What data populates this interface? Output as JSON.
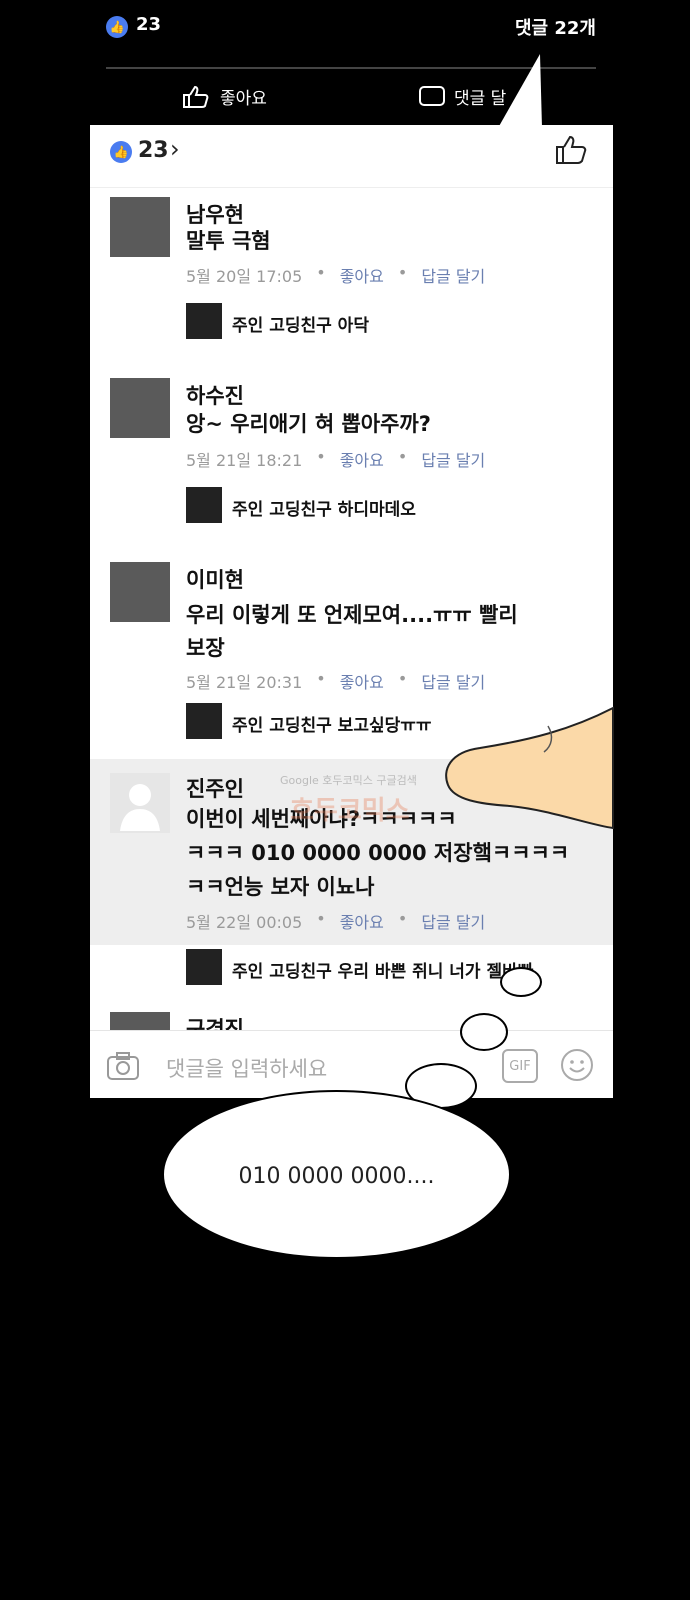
{
  "top_bar": {
    "like_count": "23",
    "comment_count": "댓글 22개",
    "like_action": "좋아요",
    "comment_action": "댓글 달"
  },
  "panel_header": {
    "like_count": "23"
  },
  "comments": [
    {
      "name": "남우현",
      "text": [
        "말투 극혐"
      ],
      "time": "5월 20일 17:05",
      "like": "좋아요",
      "reply": "답글 달기",
      "reply_preview": "주인 고딩친구  아닥"
    },
    {
      "name": "하수진",
      "text": [
        "앙~ 우리애기 혀 뽑아주까?"
      ],
      "time": "5월 21일 18:21",
      "like": "좋아요",
      "reply": "답글 달기",
      "reply_preview": "주인 고딩친구  하디마데오"
    },
    {
      "name": "이미현",
      "text": [
        "우리 이렇게 또 언제모여....ㅠㅠ 빨리",
        "보장"
      ],
      "time": "5월 21일 20:31",
      "like": "좋아요",
      "reply": "답글 달기",
      "reply_preview": "주인 고딩친구  보고싶당ㅠㅠ"
    },
    {
      "name": "진주인",
      "text": [
        "이번이 세번째아냐?ㅋㅋㅋㅋㅋ",
        "ㅋㅋㅋ 010 0000 0000 저장햌ㅋㅋㅋㅋ",
        "ㅋㅋ언능 보자 이뇨나"
      ],
      "time": "5월 22일 00:05",
      "like": "좋아요",
      "reply": "답글 달기",
      "reply_preview": "주인 고딩친구  우리 바쁜 쥐니 너가 젤바빠"
    },
    {
      "name": "구경진"
    }
  ],
  "input": {
    "placeholder": "댓글을 입력하세요",
    "gif_label": "GIF"
  },
  "watermark": {
    "search": "Google  호두코믹스  구글검색",
    "logo": "호두코믹스"
  },
  "speech_bubble": {
    "text": "010 0000 0000...."
  },
  "colors": {
    "like_blue": "#4a7cf0",
    "action_blue": "#6a7fb0",
    "highlight": "#eeeeee"
  }
}
